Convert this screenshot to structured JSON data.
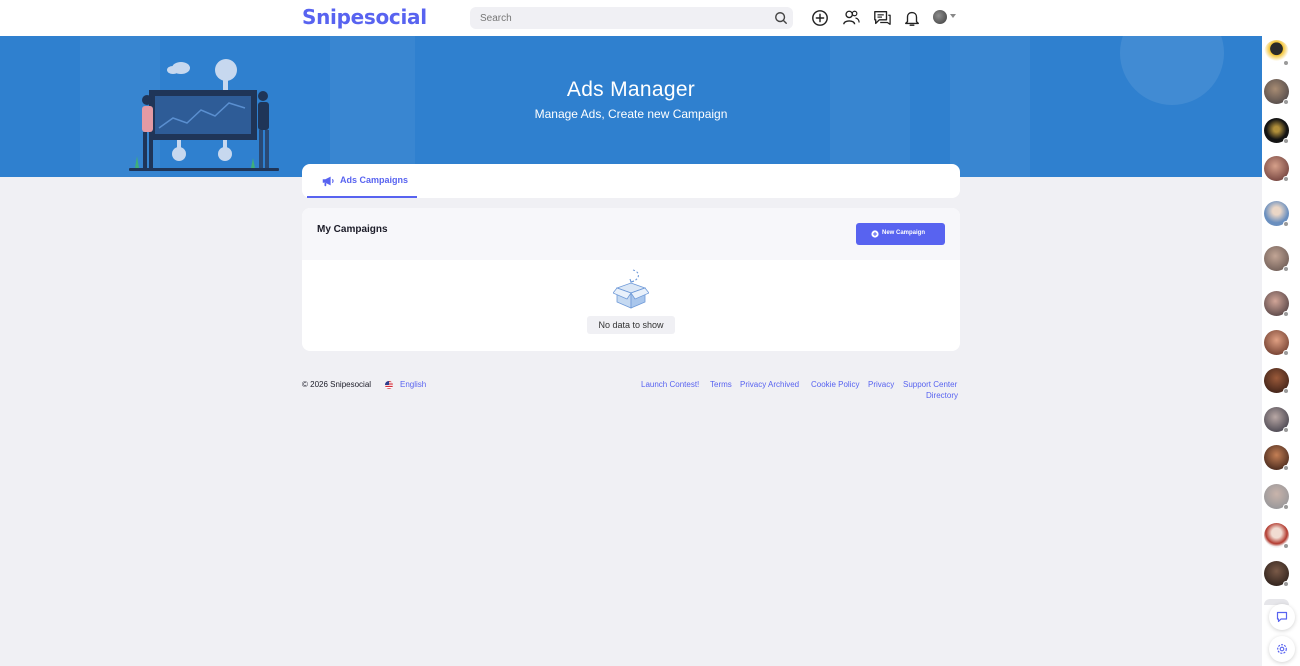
{
  "brand": {
    "name": "Snipesocial",
    "accent_color": "#5863f0",
    "banner_color": "#2f80cf"
  },
  "search": {
    "placeholder": "Search",
    "icon": "search-icon"
  },
  "nav": {
    "icons": [
      "add-circle-icon",
      "users-icon",
      "messages-icon",
      "bell-icon"
    ],
    "profile": {
      "icon": "avatar",
      "caret": "caret-down-icon"
    }
  },
  "hero": {
    "title": "Ads Manager",
    "subtitle": "Manage Ads, Create new Campaign"
  },
  "tabs": [
    {
      "label": "Ads Campaigns",
      "icon": "megaphone-icon",
      "active": true
    }
  ],
  "campaigns": {
    "title": "My Campaigns",
    "new_button": {
      "label": "New Campaign",
      "icon": "plus-circle-icon"
    },
    "empty_text": "No data to show"
  },
  "footer": {
    "copyright": "© 2026 Snipesocial",
    "language": "English",
    "links": [
      "Launch Contest!",
      "Terms",
      "Privacy Archived",
      "Cookie Policy",
      "Privacy",
      "Support Center",
      "Directory"
    ]
  },
  "sidebar": {
    "online_users": 15,
    "buttons": [
      "chat-icon",
      "settings-icon"
    ]
  }
}
